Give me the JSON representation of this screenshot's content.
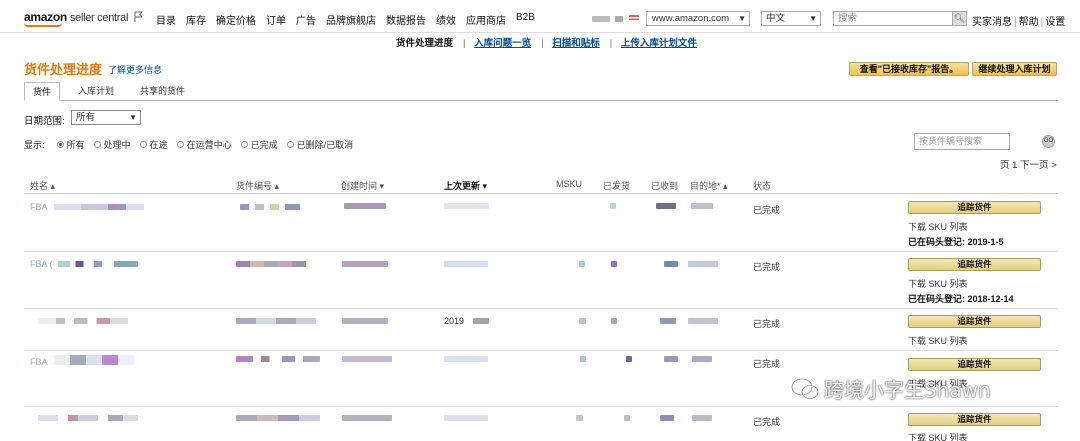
{
  "header": {
    "logo_brand": "amazon",
    "logo_product": "seller central",
    "nav": [
      "目录",
      "库存",
      "确定价格",
      "订单",
      "广告",
      "品牌旗舰店",
      "数据报告",
      "绩效",
      "应用商店",
      "B2B"
    ],
    "marketplace": "www.amazon.com",
    "language": "中文",
    "search_placeholder": "搜索",
    "links": [
      "买家消息",
      "帮助",
      "设置"
    ]
  },
  "subnav": {
    "current": "货件处理进度",
    "links": [
      "入库问题一览",
      "扫描和贴标",
      "上传入库计划文件"
    ]
  },
  "page": {
    "title": "货件处理进度",
    "learn_more": "了解更多信息",
    "report_button": "查看\"已接收库存\"报告。",
    "continue_button": "继续处理入库计划"
  },
  "tabs": [
    "货件",
    "入库计划",
    "共享的货件"
  ],
  "filters": {
    "date_label": "日期范围:",
    "date_value": "所有",
    "show_label": "显示:",
    "options": [
      "所有",
      "处理中",
      "在途",
      "在运营中心",
      "已完成",
      "已删除/已取消"
    ],
    "selected": "所有",
    "shipment_search_placeholder": "按货件编号搜索",
    "go": "GO"
  },
  "pager": "页 1  下一页 >",
  "table": {
    "columns": [
      "姓名 ▴",
      "货件编号 ▴",
      "创建时间 ▾",
      "上次更新 ▾",
      "MSKU",
      "已发货",
      "已收到",
      "目的地* ▴",
      "状态"
    ],
    "rows": [
      {
        "name": "FBA",
        "created": "",
        "updated": "",
        "status": "已完成",
        "track": "追踪货件",
        "download": "下载 SKU 列表",
        "checkin": "已在码头登记: 2019-1-5"
      },
      {
        "name": "FBA (",
        "created": "",
        "updated": "",
        "status": "已完成",
        "track": "追踪货件",
        "download": "下载 SKU 列表",
        "checkin": "已在码头登记: 2018-12-14"
      },
      {
        "name": "",
        "created": "",
        "updated": "2019",
        "status": "已完成",
        "track": "追踪货件",
        "download": "下载 SKU 列表",
        "checkin": ""
      },
      {
        "name": "FBA",
        "created": "",
        "updated": "",
        "status": "已完成",
        "track": "追踪货件",
        "download": "下载 SKU 列表",
        "checkin": ""
      },
      {
        "name": "",
        "created": "",
        "updated": "",
        "status": "已完成",
        "track": "追踪货件",
        "download": "下载 SKU 列表",
        "checkin": ""
      }
    ]
  },
  "watermark": "跨境小字生Shawn",
  "colors": {
    "accent": "#e47911",
    "link": "#004b91",
    "button": "#f0c14b"
  }
}
